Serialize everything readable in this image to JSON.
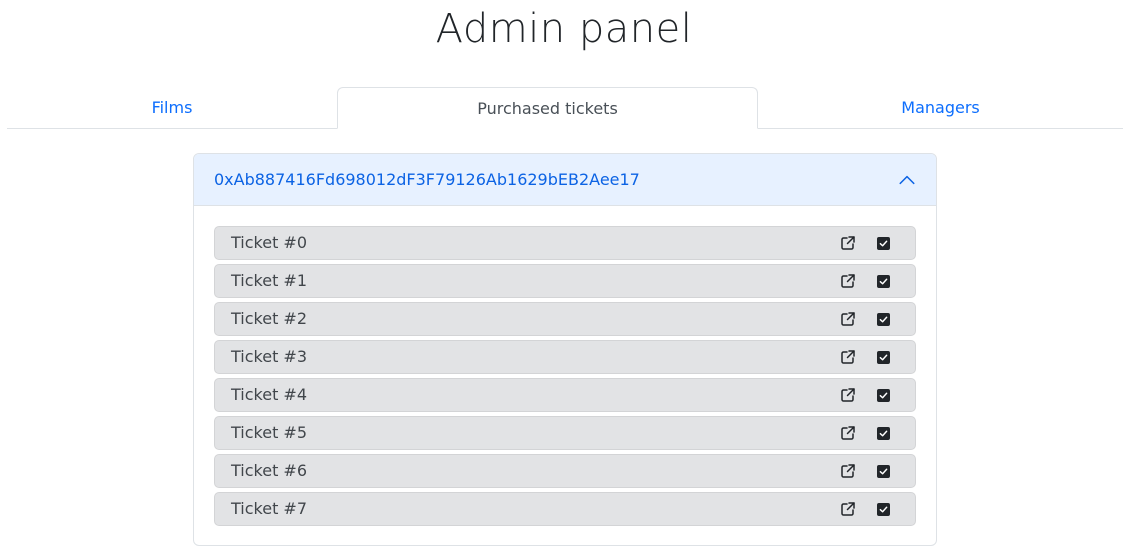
{
  "page": {
    "title": "Admin panel"
  },
  "tabs": [
    {
      "label": "Films",
      "active": false
    },
    {
      "label": "Purchased tickets",
      "active": true
    },
    {
      "label": "Managers",
      "active": false
    }
  ],
  "accordion": {
    "address": "0xAb887416Fd698012dF3F79126Ab1629bEB2Aee17",
    "expanded": true,
    "icon": "chevron-up-icon",
    "tickets": [
      {
        "label": "Ticket #0",
        "checked": true
      },
      {
        "label": "Ticket #1",
        "checked": true
      },
      {
        "label": "Ticket #2",
        "checked": true
      },
      {
        "label": "Ticket #3",
        "checked": true
      },
      {
        "label": "Ticket #4",
        "checked": true
      },
      {
        "label": "Ticket #5",
        "checked": true
      },
      {
        "label": "Ticket #6",
        "checked": true
      },
      {
        "label": "Ticket #7",
        "checked": true
      }
    ]
  },
  "colors": {
    "link": "#0d6efd",
    "accordion_header_bg": "#e7f1ff",
    "ticket_bg": "#e2e3e5"
  }
}
